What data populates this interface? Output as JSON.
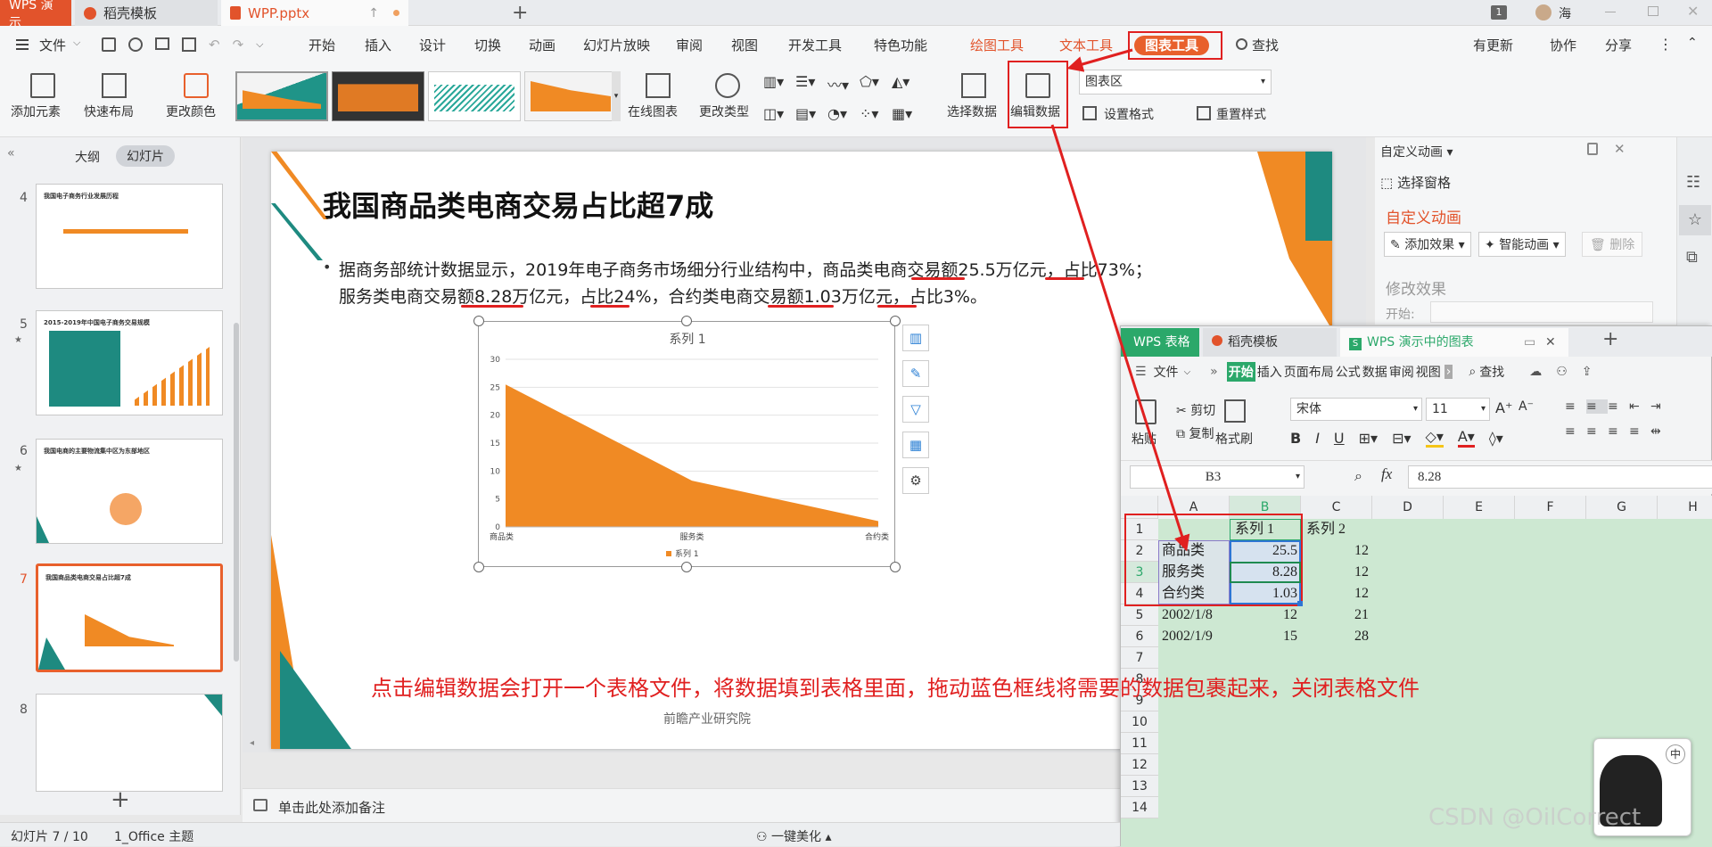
{
  "titlebar": {
    "tabs": [
      "WPS 演示",
      "稻壳模板",
      "WPP.pptx"
    ],
    "badge": "1",
    "user": "海"
  },
  "menubar": {
    "file": "文件",
    "items": [
      "开始",
      "插入",
      "设计",
      "切换",
      "动画",
      "幻灯片放映",
      "审阅",
      "视图",
      "开发工具",
      "特色功能"
    ],
    "context_tabs": [
      "绘图工具",
      "文本工具",
      "图表工具"
    ],
    "search": "查找",
    "right": [
      "有更新",
      "协作",
      "分享"
    ]
  },
  "ribbon": {
    "add_element": "添加元素",
    "quick_layout": "快速布局",
    "change_color": "更改颜色",
    "online_chart": "在线图表",
    "change_type": "更改类型",
    "select_data": "选择数据",
    "edit_data": "编辑数据",
    "chart_area_select": "图表区",
    "set_format": "设置格式",
    "reset_style": "重置样式"
  },
  "leftpane": {
    "tab_outline": "大纲",
    "tab_slides": "幻灯片",
    "slide_numbers": [
      "4",
      "5",
      "6",
      "7",
      "8"
    ],
    "thumb_titles": [
      "我国电子商务行业发展历程",
      "2015-2019年中国电子商务交易规模",
      "我国电商的主要物流集中区为东部地区",
      "我国商品类电商交易占比超7成",
      ""
    ]
  },
  "slide": {
    "title": "我国商品类电商交易占比超7成",
    "body_line1": "据商务部统计数据显示，2019年电子商务市场细分行业结构中，商品类电商交易额25.5万亿元，占比73%；",
    "body_line2": "服务类电商交易额8.28万亿元，占比24%，合约类电商交易额1.03万亿元，占比3%。",
    "source": "前瞻产业研究院",
    "annotation": "点击编辑数据会打开一个表格文件，将数据填到表格里面，拖动蓝色框线将需要的数据包裹起来，关闭表格文件"
  },
  "chart_data": {
    "type": "area",
    "title": "系列 1",
    "categories": [
      "商品类",
      "服务类",
      "合约类"
    ],
    "series": [
      {
        "name": "系列 1",
        "values": [
          25.5,
          8.28,
          1.03
        ],
        "color": "#f08a24"
      }
    ],
    "ylim": [
      0,
      30
    ],
    "yticks": [
      0,
      5,
      10,
      15,
      20,
      25,
      30
    ],
    "grid": true,
    "legend": "bottom"
  },
  "rightpane": {
    "header": "自定义动画",
    "select_pane": "选择窗格",
    "section": "自定义动画",
    "add_effect": "添加效果",
    "smart_anim": "智能动画",
    "delete": "删除",
    "modify": "修改效果",
    "start_label": "开始:"
  },
  "sheet": {
    "tabs": [
      "WPS 表格",
      "稻壳模板",
      "WPS 演示中的图表"
    ],
    "menu": [
      "文件",
      "开始",
      "插入",
      "页面布局",
      "公式",
      "数据",
      "审阅",
      "视图"
    ],
    "search": "查找",
    "paste": "粘贴",
    "cut": "剪切",
    "copy": "复制",
    "format_painter": "格式刷",
    "font": "宋体",
    "size": "11",
    "namebox": "B3",
    "formula": "8.28",
    "columns": [
      "A",
      "B",
      "C",
      "D",
      "E",
      "F",
      "G",
      "H"
    ],
    "rows": [
      "1",
      "2",
      "3",
      "4",
      "5",
      "6",
      "7",
      "8",
      "9",
      "10",
      "11",
      "12",
      "13",
      "14"
    ],
    "cells": {
      "B1": "系列 1",
      "C1": "系列 2",
      "A2": "商品类",
      "B2": "25.5",
      "C2": "12",
      "A3": "服务类",
      "B3": "8.28",
      "C3": "12",
      "A4": "合约类",
      "B4": "1.03",
      "C4": "12",
      "A5": "2002/1/8",
      "B5": "12",
      "C5": "21",
      "A6": "2002/1/9",
      "B6": "15",
      "C6": "28"
    }
  },
  "statusbar": {
    "slide_info": "幻灯片 7 / 10",
    "theme": "1_Office 主题",
    "beautify": "一键美化",
    "notes": "单击此处添加备注"
  },
  "watermark": "CSDN @OilCorrect"
}
